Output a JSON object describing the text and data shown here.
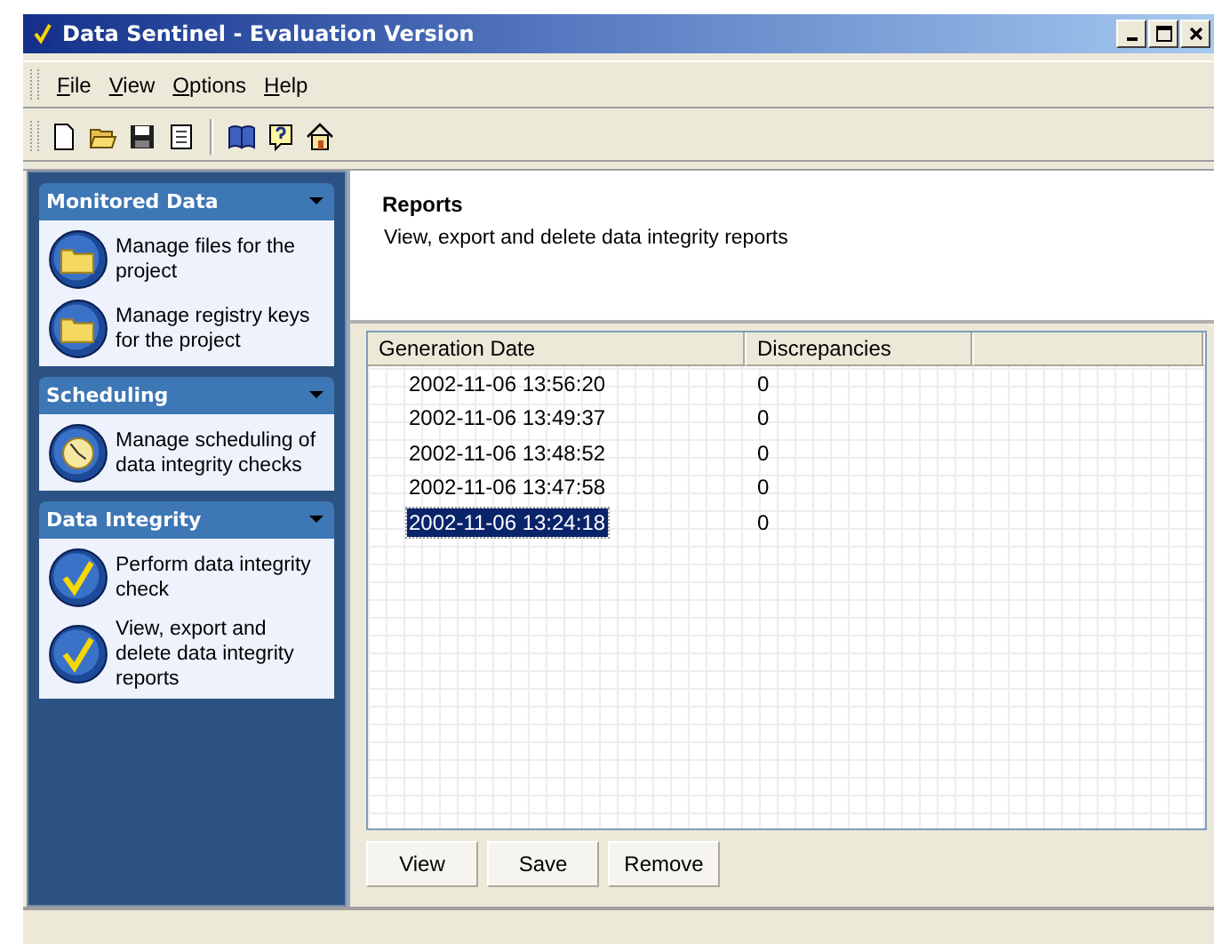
{
  "window": {
    "title": "Data Sentinel - Evaluation Version"
  },
  "menu": [
    "File",
    "View",
    "Options",
    "Help"
  ],
  "toolbar": [
    {
      "kind": "new"
    },
    {
      "kind": "open"
    },
    {
      "kind": "save"
    },
    {
      "kind": "page"
    },
    {
      "kind": "separator"
    },
    {
      "kind": "book"
    },
    {
      "kind": "help"
    },
    {
      "kind": "home"
    }
  ],
  "sidebar": {
    "groups": [
      {
        "title": "Monitored Data",
        "items": [
          {
            "label": "Manage files for the project",
            "kind": "folder"
          },
          {
            "label": "Manage registry keys for the project",
            "kind": "folder"
          }
        ]
      },
      {
        "title": "Scheduling",
        "items": [
          {
            "label": "Manage scheduling of data integrity checks",
            "kind": "clock"
          }
        ]
      },
      {
        "title": "Data Integrity",
        "items": [
          {
            "label": "Perform data integrity check",
            "kind": "check"
          },
          {
            "label": "View, export and delete data integrity reports",
            "kind": "check"
          }
        ]
      }
    ]
  },
  "header": {
    "title": "Reports",
    "subtitle": "View, export and delete data integrity reports"
  },
  "table": {
    "columns": [
      "Generation Date",
      "Discrepancies"
    ],
    "rows": [
      {
        "date": "2002-11-06 13:56:20",
        "discrepancies": "0",
        "selected": false
      },
      {
        "date": "2002-11-06 13:49:37",
        "discrepancies": "0",
        "selected": false
      },
      {
        "date": "2002-11-06 13:48:52",
        "discrepancies": "0",
        "selected": false
      },
      {
        "date": "2002-11-06 13:47:58",
        "discrepancies": "0",
        "selected": false
      },
      {
        "date": "2002-11-06 13:24:18",
        "discrepancies": "0",
        "selected": true
      }
    ]
  },
  "buttons": [
    "View",
    "Save",
    "Remove"
  ]
}
